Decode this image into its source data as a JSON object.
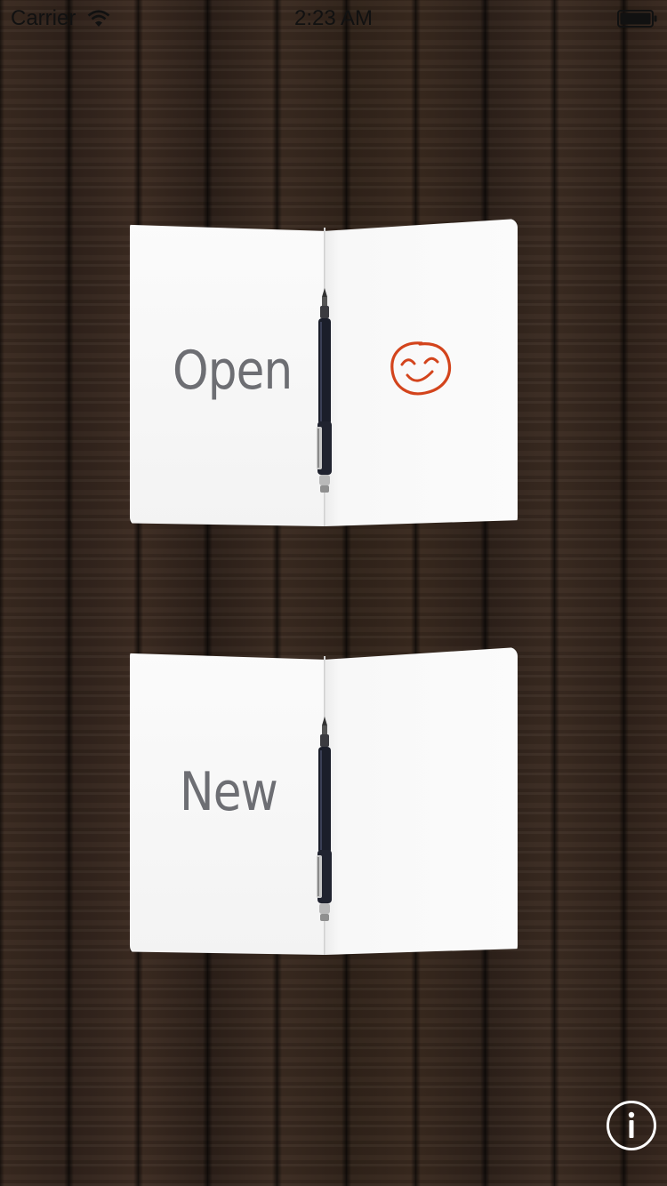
{
  "status_bar": {
    "carrier": "Carrier",
    "time": "2:23 AM",
    "wifi_icon": "wifi-icon",
    "battery_icon": "battery-icon"
  },
  "notebooks": {
    "open": {
      "label": "Open",
      "decoration_icon": "smiley-icon",
      "decoration_color": "#d3441c"
    },
    "new": {
      "label": "New"
    },
    "pen_icon": "pen-icon"
  },
  "info_button": {
    "icon": "info-icon"
  },
  "colors": {
    "label_text": "#6d6e73",
    "paper": "#fbfbfb",
    "wood": "#33241b"
  }
}
